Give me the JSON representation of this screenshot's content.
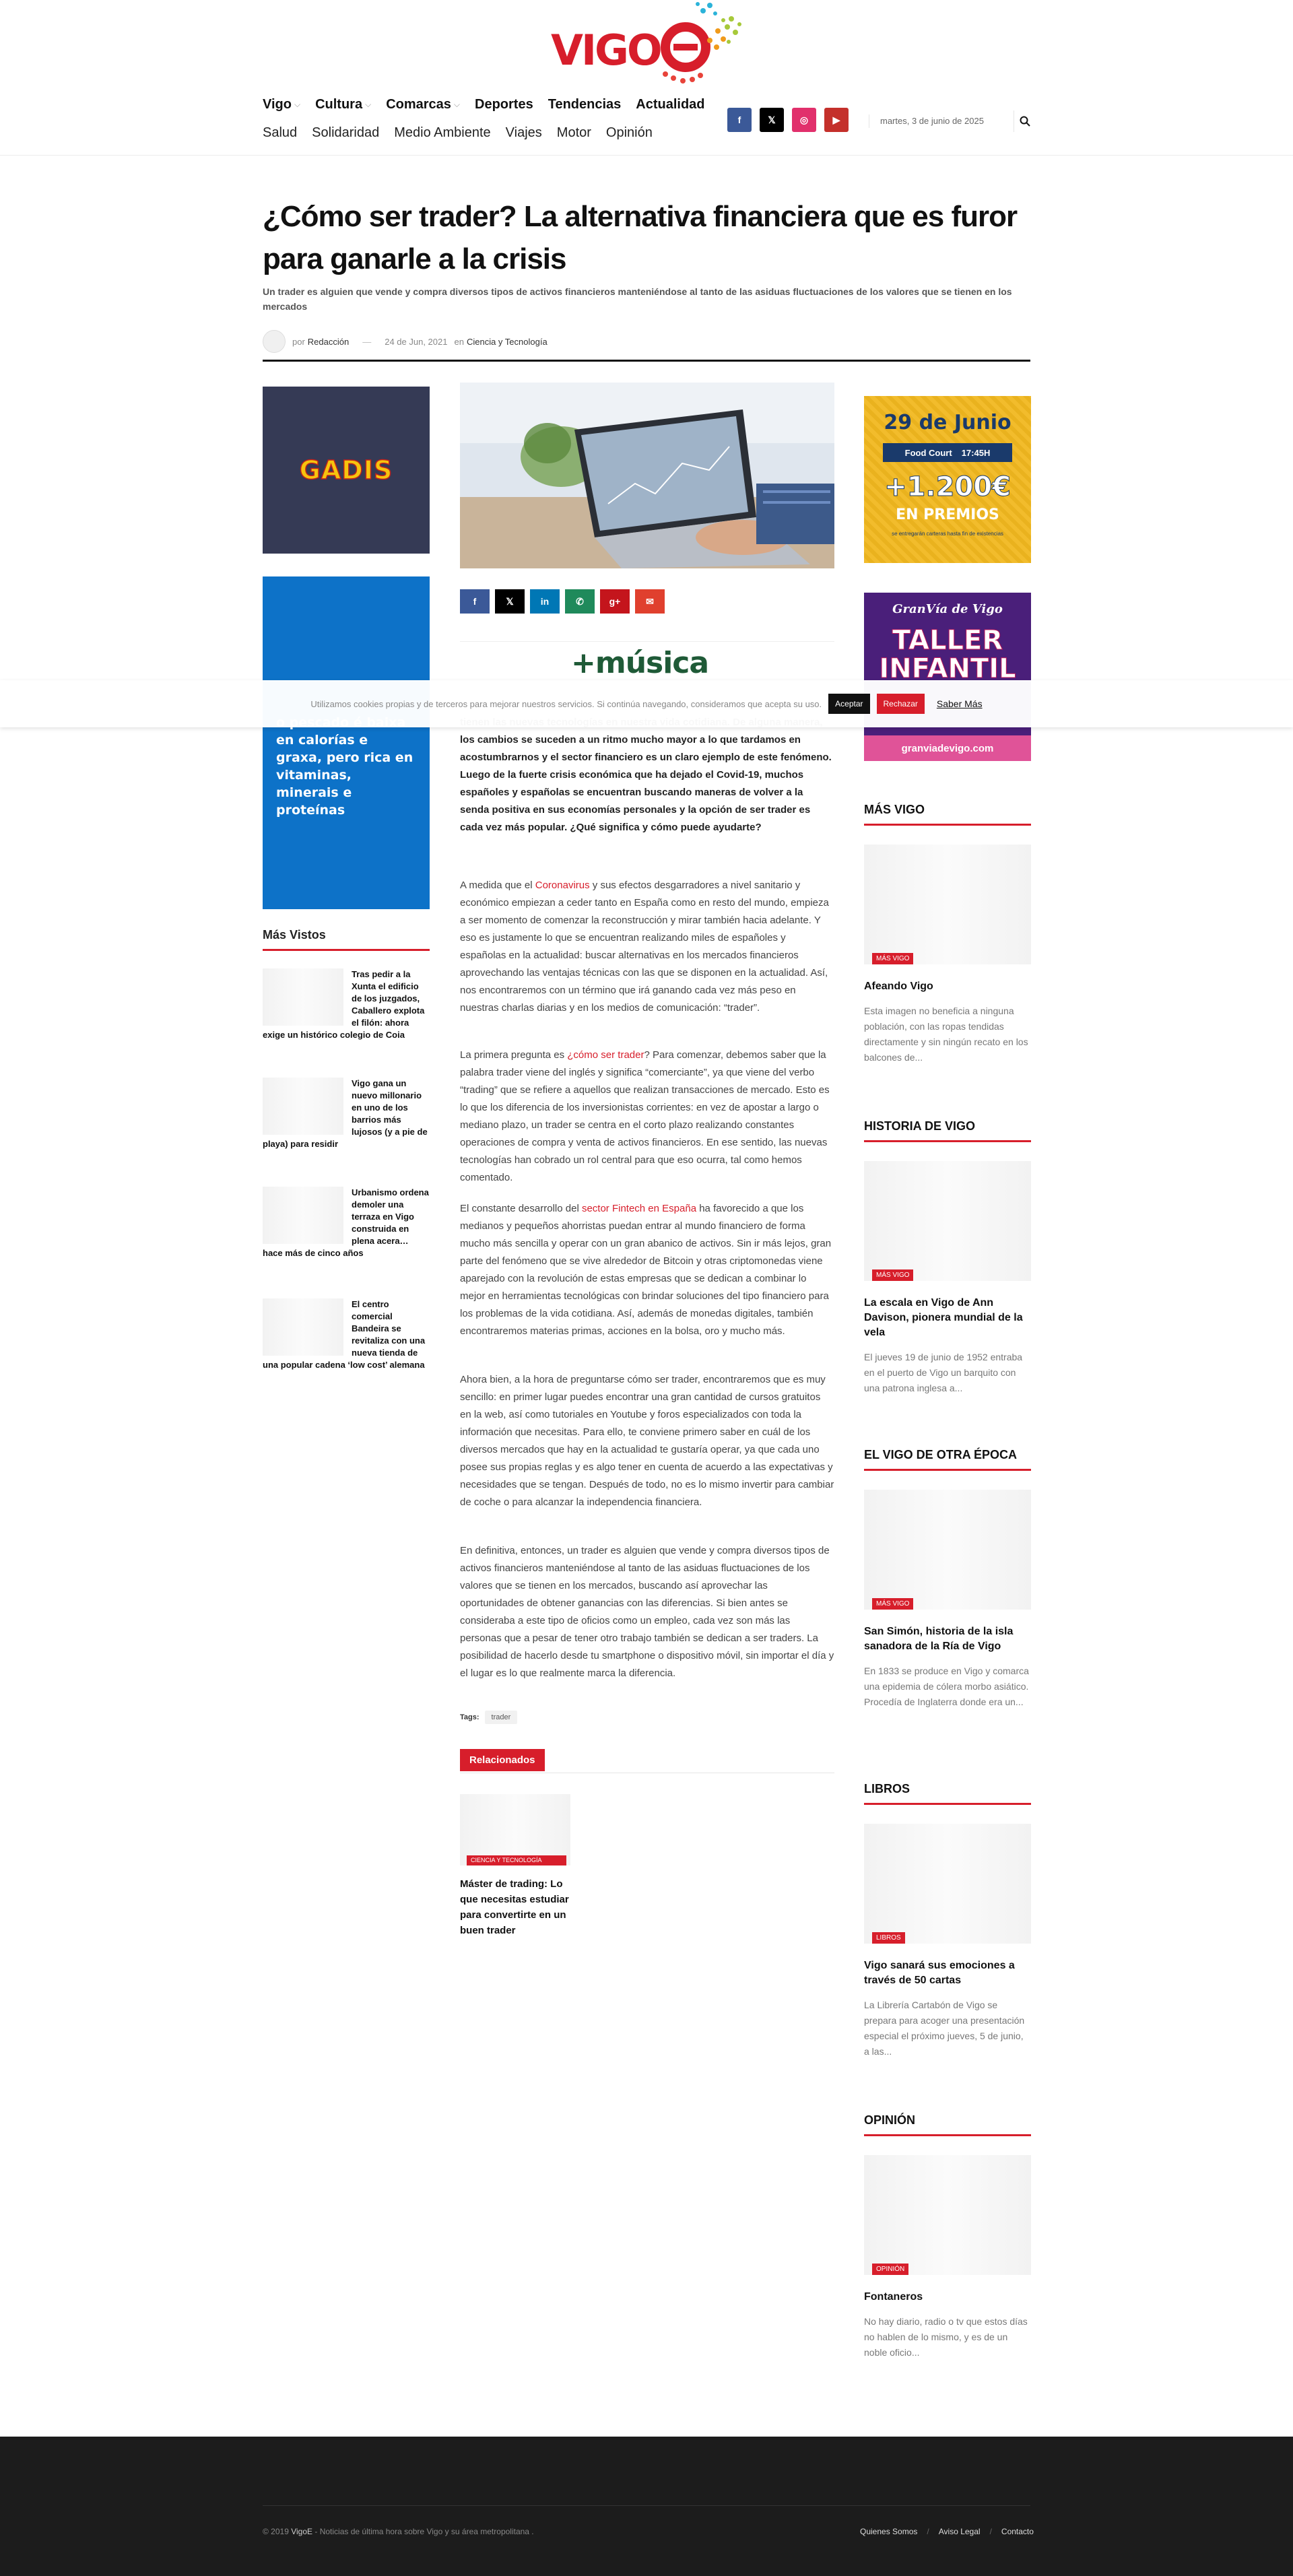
{
  "header": {
    "nav_primary": [
      {
        "label": "Vigo",
        "has_dropdown": true
      },
      {
        "label": "Cultura",
        "has_dropdown": true
      },
      {
        "label": "Comarcas",
        "has_dropdown": true
      },
      {
        "label": "Deportes",
        "has_dropdown": false
      },
      {
        "label": "Tendencias",
        "has_dropdown": false
      },
      {
        "label": "Actualidad",
        "has_dropdown": false
      }
    ],
    "nav_secondary": [
      "Salud",
      "Solidaridad",
      "Medio Ambiente",
      "Viajes",
      "Motor",
      "Opinión"
    ],
    "social": [
      {
        "icon": "facebook-icon",
        "glyph": "f",
        "color": "#3b5998"
      },
      {
        "icon": "x-icon",
        "glyph": "𝕏",
        "color": "#000000"
      },
      {
        "icon": "instagram-icon",
        "glyph": "◎",
        "color": "#e1306c"
      },
      {
        "icon": "youtube-icon",
        "glyph": "▶",
        "color": "#c4302b"
      }
    ],
    "date": "martes, 3 de junio de 2025",
    "logo_text": "VIGO"
  },
  "article": {
    "title": "¿Cómo ser trader? La alternativa financiera que es furor para ganarle a la crisis",
    "subtitle": "Un trader es alguien que vende y compra diversos tipos de activos financieros manteniéndose al tanto de las asiduas fluctuaciones de los valores que se tienen en los mercados",
    "meta": {
      "by": "por",
      "author": "Redacción",
      "date": "24 de Jun, 2021",
      "in": "en",
      "category": "Ciencia y Tecnología"
    },
    "share": [
      {
        "icon": "facebook-icon",
        "glyph": "f",
        "color": "#3b5998"
      },
      {
        "icon": "x-icon",
        "glyph": "𝕏",
        "color": "#000000"
      },
      {
        "icon": "linkedin-icon",
        "glyph": "in",
        "color": "#0077b5"
      },
      {
        "icon": "whatsapp-icon",
        "glyph": "✆",
        "color": "#1f8a5b"
      },
      {
        "icon": "google-plus-icon",
        "glyph": "g+",
        "color": "#c4151c"
      },
      {
        "icon": "email-icon",
        "glyph": "✉",
        "color": "#e0402e"
      }
    ],
    "banner_text": "+música",
    "lead": "tienen las nuevas tecnologías en nuestra vida cotidiana. De alguna manera, los cambios se suceden a un ritmo mucho mayor a lo que tardamos en acostumbrarnos y el sector financiero es un claro ejemplo de este fenómeno. Luego de la fuerte crisis económica que ha dejado el Covid-19, muchos españoles y españolas se encuentran buscando maneras de volver a la senda positiva en sus economías personales y la opción de ser trader es cada vez más popular. ¿Qué significa y cómo puede ayudarte?",
    "p1_pre": "A medida que el ",
    "p1_link": "Coronavirus",
    "p1_post": " y sus efectos desgarradores a nivel sanitario y económico empiezan a ceder tanto en España como en resto del mundo, empieza a ser momento de comenzar la reconstrucción y mirar también hacia adelante. Y eso es justamente lo que se encuentran realizando miles de españoles y españolas en la actualidad: buscar alternativas en los mercados financieros aprovechando las ventajas técnicas con las que se disponen en la actualidad. Así, nos encontraremos con un término que irá ganando cada vez más peso en nuestras charlas diarias y en los medios de comunicación: “trader”.",
    "p2_pre": "La primera pregunta es ",
    "p2_link": "¿cómo ser trader",
    "p2_post": "? Para comenzar, debemos saber que la palabra trader viene del inglés y significa “comerciante”, ya que viene del verbo “trading” que se refiere a aquellos que realizan transacciones de mercado. Esto es lo que los diferencia de los inversionistas corrientes: en vez de apostar a largo o mediano plazo, un trader se centra en el corto plazo realizando constantes operaciones de compra y venta de activos financieros. En ese sentido, las nuevas tecnologías han cobrado un rol central para que eso ocurra, tal como hemos comentado.",
    "p3_pre": "El constante desarrollo del ",
    "p3_link": "sector Fintech en España",
    "p3_post": " ha favorecido a que los medianos y pequeños ahorristas puedan entrar al mundo financiero de forma mucho más sencilla y operar con un gran abanico de activos. Sin ir más lejos, gran parte del fenómeno que se vive alrededor de Bitcoin y otras criptomonedas viene aparejado con la revolución de estas empresas que se dedican a combinar lo mejor en herramientas tecnológicas con brindar soluciones del tipo financiero para los problemas de la vida cotidiana. Así, además de monedas digitales, también encontraremos materias primas, acciones en la bolsa, oro y mucho más.",
    "p4": "Ahora bien, a la hora de preguntarse cómo ser trader, encontraremos que es muy sencillo: en primer lugar puedes encontrar una gran cantidad de cursos gratuitos en la web, así como tutoriales en Youtube y foros especializados con toda la información que necesitas. Para ello, te conviene primero saber en cuál de los diversos mercados que hay en la actualidad te gustaría operar, ya que cada uno posee sus propias reglas y es algo tener en cuenta de acuerdo a las expectativas y necesidades que se tengan. Después de todo, no es lo mismo invertir para cambiar de coche o para alcanzar la independencia financiera.",
    "p5": "En definitiva, entonces, un trader es alguien que vende y compra diversos tipos de activos financieros manteniéndose al tanto de las asiduas fluctuaciones de los valores que se tienen en los mercados, buscando así aprovechar las oportunidades de obtener ganancias con las diferencias. Si bien antes se consideraba a este tipo de oficios como un empleo, cada vez son más las personas que a pesar de tener otro trabajo también se dedican a ser traders. La posibilidad de hacerlo desde tu smartphone o dispositivo móvil, sin importar el día y el lugar es lo que realmente marca la diferencia.",
    "tags_label": "Tags:",
    "tags": [
      "trader"
    ],
    "related_label": "Relacionados",
    "related": [
      {
        "category": "CIENCIA Y TECNOLOGÍA",
        "title": "Máster de trading: Lo que necesitas estudiar para convertirte en un buen trader"
      }
    ]
  },
  "left_sidebar": {
    "gadis_text": "GADIS",
    "blue_ad_text": "o pescado é baixa en calorías e graxa, pero rica en vitaminas, minerais e proteínas",
    "mas_vistos_label": "Más Vistos",
    "mas_vistos": [
      "Tras pedir a la Xunta el edificio de los juzgados, Caballero explota el filón: ahora exige un histórico colegio de Coia",
      "Vigo gana un nuevo millonario en uno de los barrios más lujosos (y a pie de playa) para residir",
      "Urbanismo ordena demoler una terraza en Vigo construida en plena acera… hace más de cinco años",
      "El centro comercial Bandeira se revitaliza con una nueva tienda de una popular cadena ‘low cost’ alemana"
    ]
  },
  "right_sidebar": {
    "ad1": {
      "date": "29 de Junio",
      "place": "Food Court",
      "time": "17:45H",
      "amount": "+1.200€",
      "premios": "EN PREMIOS",
      "note": "se entregarán carteras hasta fin de existencias"
    },
    "ad2": {
      "brand": "GranVía de Vigo",
      "line1": "TALLER",
      "line2": "INFANTIL",
      "url": "granviadevigo.com"
    },
    "sections": [
      {
        "head": "MÁS VIGO",
        "cat": "MÁS VIGO",
        "title": "Afeando Vigo",
        "desc": "Esta imagen no beneficia a ninguna población, con las ropas tendidas directamente y sin ningún recato en los balcones de..."
      },
      {
        "head": "HISTORIA DE VIGO",
        "cat": "MÁS VIGO",
        "title": "La escala en Vigo de Ann Davison, pionera mundial de la vela",
        "desc": "El jueves 19 de junio de 1952 entraba en el puerto de Vigo un barquito con una patrona inglesa a..."
      },
      {
        "head": "EL VIGO DE OTRA ÉPOCA",
        "cat": "MÁS VIGO",
        "title": "San Simón, historia de la isla sanadora de la Ría de Vigo",
        "desc": "En 1833 se produce en Vigo y comarca una epidemia de cólera morbo asiático. Procedía de Inglaterra donde era un..."
      },
      {
        "head": "LIBROS",
        "cat": "LIBROS",
        "title": "Vigo sanará sus emociones a través de 50 cartas",
        "desc": "La Librería Cartabón de Vigo se prepara para acoger una presentación especial el próximo jueves, 5 de junio, a las..."
      },
      {
        "head": "OPINIÓN",
        "cat": "OPINIÓN",
        "title": "Fontaneros",
        "desc": "No hay diario, radio o tv que estos días no hablen de lo mismo, y es de un noble oficio..."
      }
    ]
  },
  "cookie": {
    "text": "Utilizamos cookies propias y de terceros para mejorar nuestros servicios. Si continúa navegando, consideramos que acepta su uso.",
    "accept": "Aceptar",
    "reject": "Rechazar",
    "more": "Saber Más"
  },
  "footer": {
    "copy_pre": "© 2019 ",
    "copy_brand": "VigoE",
    "copy_post": " - Noticias de última hora sobre Vigo y su área metropolitana .",
    "links": [
      "Quienes Somos",
      "Aviso Legal",
      "Contacto"
    ]
  },
  "colors": {
    "accent": "#d71e2b",
    "footer_bg": "#1c1c1c"
  }
}
